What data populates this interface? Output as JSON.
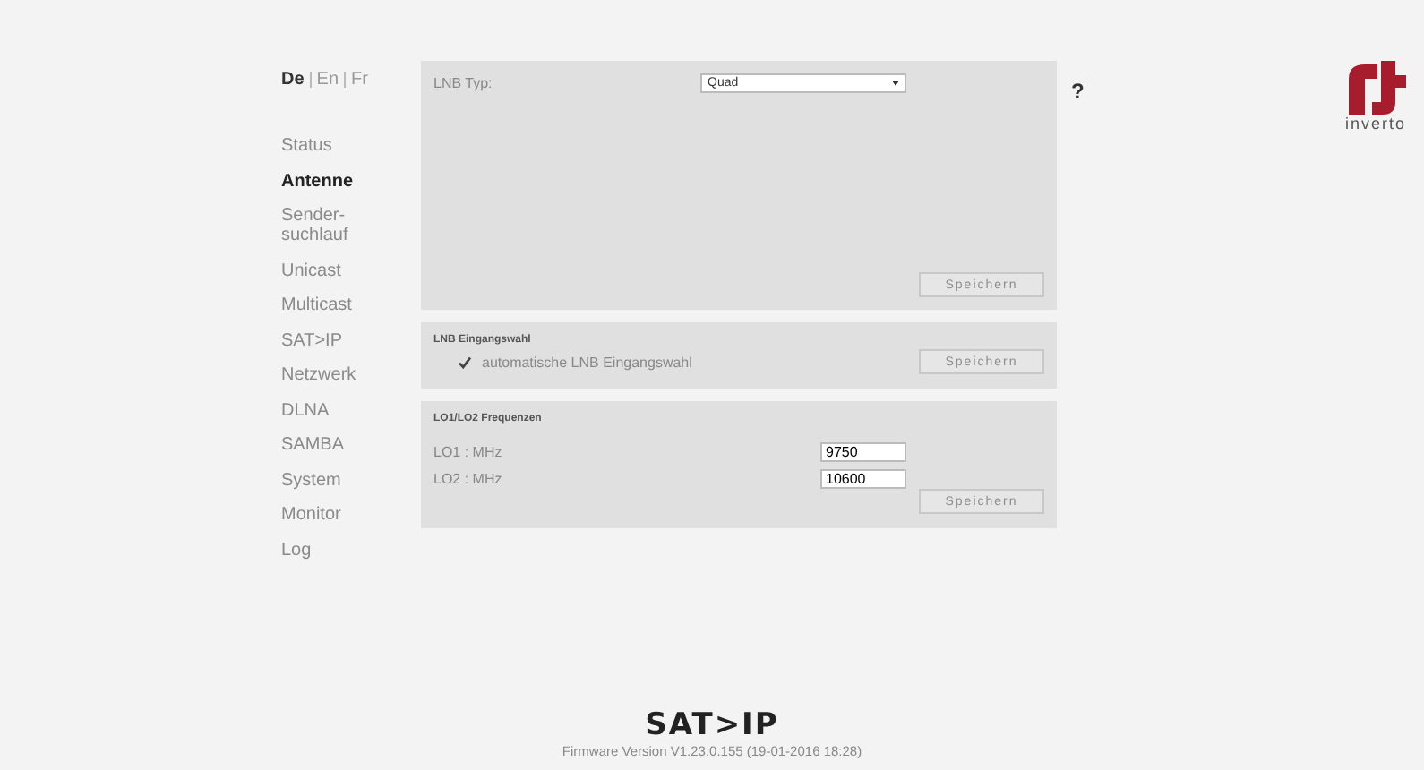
{
  "languages": [
    {
      "label": "De",
      "selected": true
    },
    {
      "label": "En",
      "selected": false
    },
    {
      "label": "Fr",
      "selected": false
    }
  ],
  "nav": [
    {
      "label": "Status",
      "selected": false
    },
    {
      "label": "Antenne",
      "selected": true
    },
    {
      "label": "Sender-\nsuchlauf",
      "selected": false
    },
    {
      "label": "Unicast",
      "selected": false
    },
    {
      "label": "Multicast",
      "selected": false
    },
    {
      "label": "SAT>IP",
      "selected": false
    },
    {
      "label": "Netzwerk",
      "selected": false
    },
    {
      "label": "DLNA",
      "selected": false
    },
    {
      "label": "SAMBA",
      "selected": false
    },
    {
      "label": "System",
      "selected": false
    },
    {
      "label": "Monitor",
      "selected": false
    },
    {
      "label": "Log",
      "selected": false
    }
  ],
  "lnb_type": {
    "label": "LNB Typ:",
    "value": "Quad",
    "save": "Speichern"
  },
  "lnb_input": {
    "title": "LNB Eingangswahl",
    "checkbox_label": "automatische LNB Eingangswahl",
    "checked": true,
    "save": "Speichern"
  },
  "lo_freq": {
    "title": "LO1/LO2 Frequenzen",
    "fields": [
      {
        "label": "LO1 : MHz",
        "value": "9750"
      },
      {
        "label": "LO2 : MHz",
        "value": "10600"
      }
    ],
    "save": "Speichern"
  },
  "help": "?",
  "brand": {
    "wordmark": "inverto"
  },
  "footer": {
    "logo": "SAT>IP",
    "version": "Firmware Version V1.23.0.155 (19-01-2016 18:28)"
  }
}
